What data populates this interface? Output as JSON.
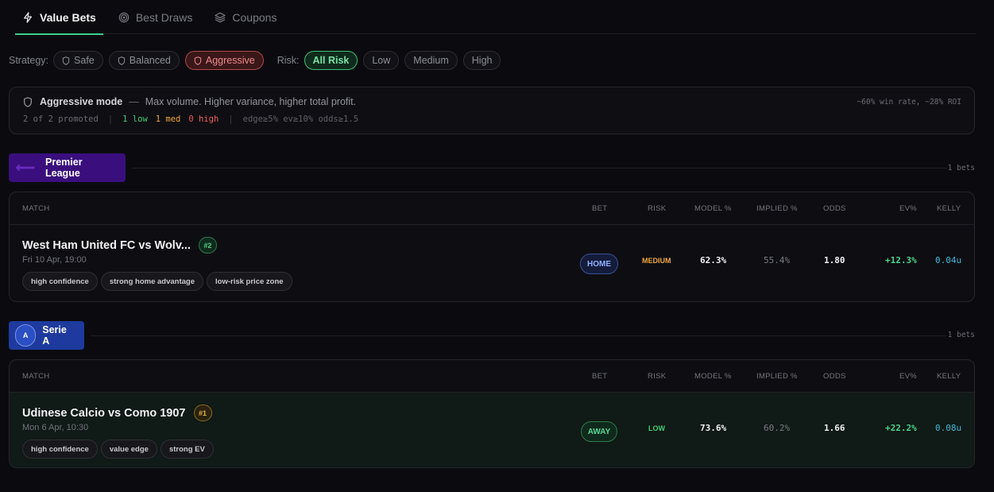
{
  "tabs": [
    {
      "label": "Value Bets",
      "icon": "bolt-icon",
      "active": true
    },
    {
      "label": "Best Draws",
      "icon": "target-icon",
      "active": false
    },
    {
      "label": "Coupons",
      "icon": "layers-icon",
      "active": false
    }
  ],
  "filters": {
    "strategy_label": "Strategy:",
    "strategies": [
      "Safe",
      "Balanced",
      "Aggressive"
    ],
    "risk_label": "Risk:",
    "risks": [
      "All Risk",
      "Low",
      "Medium",
      "High"
    ]
  },
  "info": {
    "title": "Aggressive mode",
    "dash": "—",
    "description": "Max volume. Higher variance, higher total profit.",
    "stats": "~60% win rate, ~28% ROI",
    "promoted": "2 of 2 promoted",
    "low": "1 low",
    "med": "1 med",
    "high": "0 high",
    "thresholds": "edge≥5% ev≥10% odds≥1.5"
  },
  "columns": {
    "match": "MATCH",
    "bet": "BET",
    "risk": "RISK",
    "model": "MODEL %",
    "implied": "IMPLIED %",
    "odds": "ODDS",
    "ev": "EV%",
    "kelly": "KELLY"
  },
  "leagues": [
    {
      "name": "Premier League",
      "count": "1 bets",
      "match": {
        "name": "West Ham United FC vs Wolv...",
        "rank": "#2",
        "date": "Fri 10 Apr, 19:00",
        "tags": [
          "high confidence",
          "strong home advantage",
          "low-risk price zone"
        ],
        "bet": "HOME",
        "risk": "MEDIUM",
        "model": "62.3%",
        "implied": "55.4%",
        "odds": "1.80",
        "ev": "+12.3%",
        "kelly": "0.04u"
      }
    },
    {
      "name": "Serie A",
      "count": "1 bets",
      "logo_text": "A",
      "match": {
        "name": "Udinese Calcio vs Como 1907",
        "rank": "#1",
        "date": "Mon 6 Apr, 10:30",
        "tags": [
          "high confidence",
          "value edge",
          "strong EV"
        ],
        "bet": "AWAY",
        "risk": "LOW",
        "model": "73.6%",
        "implied": "60.2%",
        "odds": "1.66",
        "ev": "+22.2%",
        "kelly": "0.08u"
      }
    }
  ],
  "colors": {
    "accent": "#3ecf8e",
    "aggressive": "#f08a8a",
    "premier_league": "#3a0f7d",
    "serie_a": "#1e3a9e",
    "risk_medium": "#f0a53a",
    "risk_low": "#3fcf78",
    "kelly": "#3fb8d8"
  }
}
